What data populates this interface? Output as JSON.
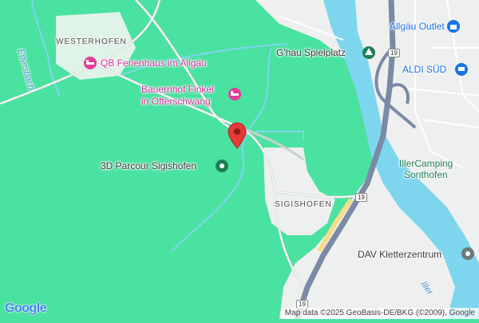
{
  "map": {
    "pois": {
      "qb_ferienhaus": "QB Ferienhaus im Allgäu",
      "bauernhof_line1": "Bauernhof Finkel",
      "bauernhof_line2": "in Ofterschwang",
      "parcour": "3D Parcour Sigishofen",
      "spielplatz": "G'hau Spielplatz",
      "allgau_outlet": "Allgäu Outlet",
      "aldi": "ALDI SÜD",
      "camping_line1": "IllerCamping",
      "camping_line2": "Sonthofen",
      "dav": "DAV Kletterzentrum"
    },
    "places": {
      "westerhofen": "WESTERHOFEN",
      "sigishofen": "SIGISHOFEN"
    },
    "water": {
      "ettersbach": "Ettersbach",
      "iller": "Iller"
    },
    "road_shields": [
      "19",
      "19",
      "19"
    ],
    "attribution": "Map data ©2025 GeoBasis-DE/BKG (©2009), Google",
    "logo": "Google",
    "colors": {
      "land": "#4ae2a0",
      "urban": "#eef0ef",
      "water": "#7ed6ee",
      "marker": "#e53935",
      "poi_pink": "#e33c9d",
      "poi_green": "#1b7f52"
    }
  }
}
